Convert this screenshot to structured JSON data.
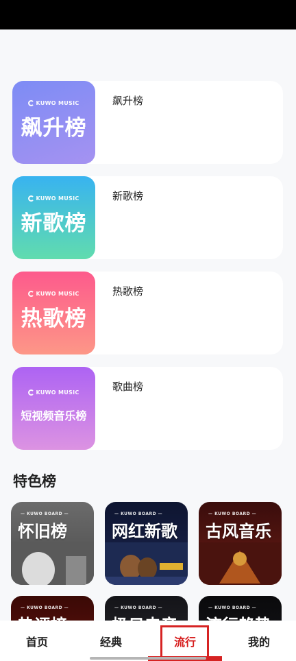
{
  "charts": [
    {
      "name": "飙升榜",
      "cover_brand": "KUWO MUSIC",
      "cover_title": "飙升榜",
      "colors": [
        "#7d8cf5",
        "#a08ef2"
      ]
    },
    {
      "name": "新歌榜",
      "cover_brand": "KUWO MUSIC",
      "cover_title": "新歌榜",
      "colors": [
        "#3ab6ee",
        "#5dd9b1"
      ]
    },
    {
      "name": "热歌榜",
      "cover_brand": "KUWO MUSIC",
      "cover_title": "热歌榜",
      "colors": [
        "#fc5b8a",
        "#fd9388"
      ]
    },
    {
      "name": "歌曲榜",
      "cover_brand": "KUWO MUSIC",
      "cover_title": "短视频音乐榜",
      "colors": [
        "#b063f2",
        "#d88ee4"
      ]
    }
  ],
  "featured": {
    "title": "特色榜",
    "cards": [
      {
        "brand": "— KUWO BOARD —",
        "title": "怀旧榜"
      },
      {
        "brand": "— KUWO BOARD —",
        "title": "网红新歌"
      },
      {
        "brand": "— KUWO BOARD —",
        "title": "古风音乐"
      },
      {
        "brand": "— KUWO BOARD —",
        "title": "热评榜"
      },
      {
        "brand": "— KUWO BOARD —",
        "title": "极日电音"
      },
      {
        "brand": "— KUWO BOARD —",
        "title": "流行趋势"
      }
    ]
  },
  "tabbar": {
    "tabs": [
      "首页",
      "经典",
      "流行",
      "我的"
    ],
    "active": "流行",
    "accent_color": "#d62323"
  }
}
